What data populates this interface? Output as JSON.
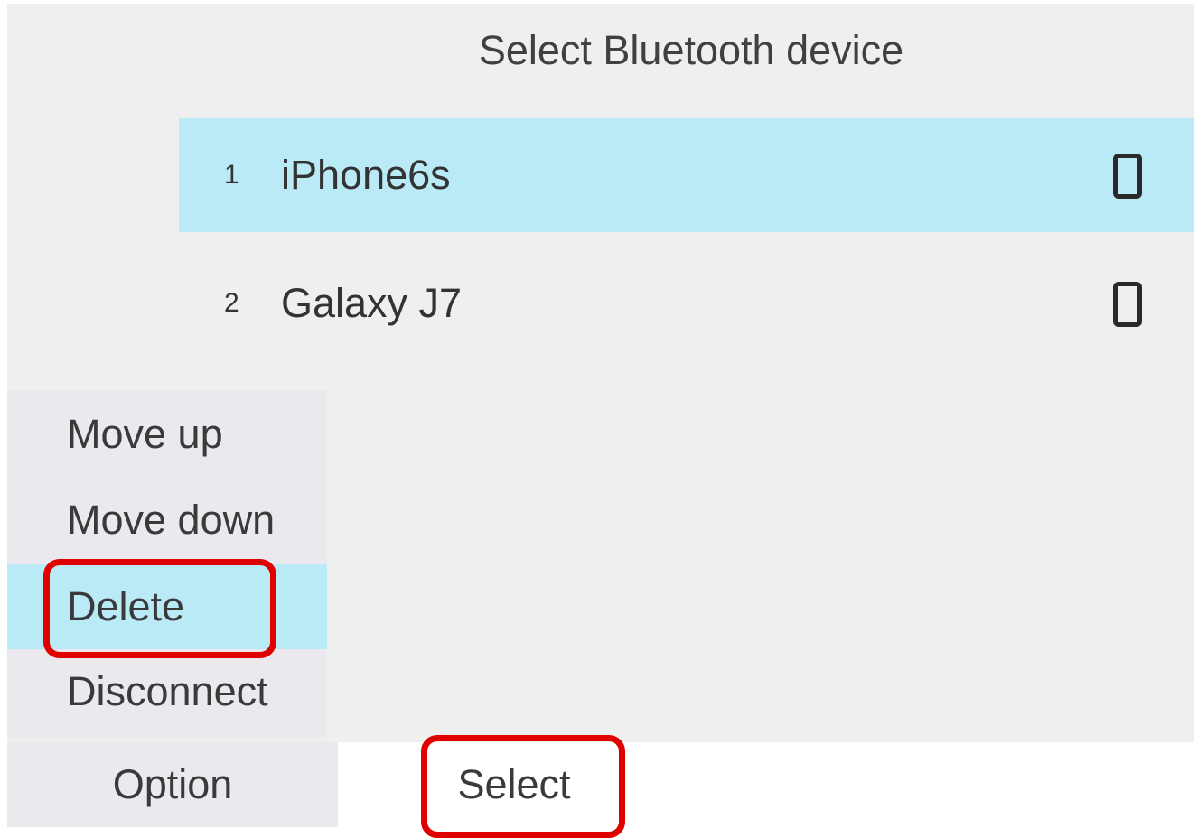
{
  "screen": {
    "title": "Select Bluetooth device"
  },
  "devices": [
    {
      "number": "1",
      "name": "iPhone6s",
      "icon": "phone-icon",
      "selected": true
    },
    {
      "number": "2",
      "name": "Galaxy J7",
      "icon": "phone-icon",
      "selected": false
    }
  ],
  "option_menu": {
    "items": [
      {
        "label": "Move up"
      },
      {
        "label": "Move down"
      },
      {
        "label": "Delete",
        "highlighted": true
      },
      {
        "label": "Disconnect"
      }
    ]
  },
  "softkeys": {
    "option_label": "Option",
    "select_label": "Select"
  },
  "colors": {
    "highlight": "#b9eaf6",
    "annotation": "#e00000",
    "background": "#f0eff0"
  }
}
